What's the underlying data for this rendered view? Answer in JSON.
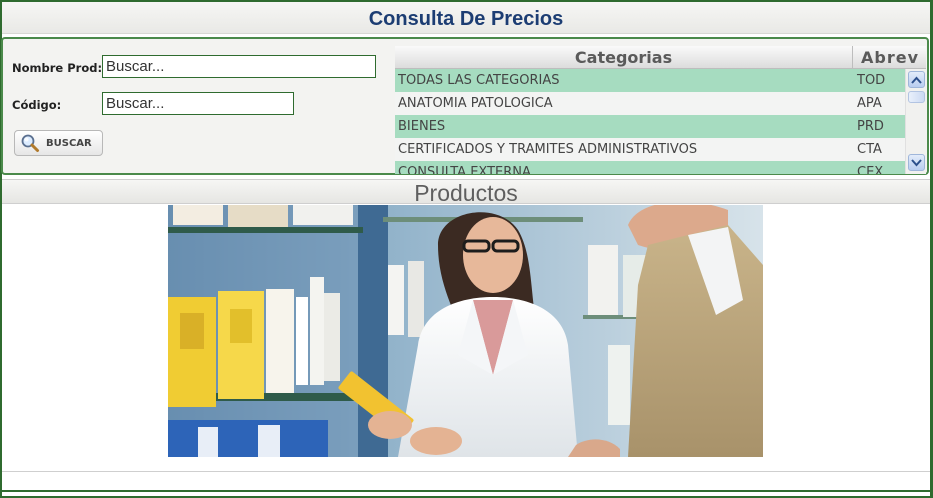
{
  "header": {
    "title": "Consulta De Precios"
  },
  "search": {
    "nombre_label": "Nombre Prod:",
    "nombre_value": "Buscar...",
    "codigo_label": "Código:",
    "codigo_value": "Buscar...",
    "button_label": "BUSCAR",
    "button_icon": "magnifier-icon"
  },
  "categories": {
    "columns": [
      "Categorias",
      "Abrev"
    ],
    "rows": [
      {
        "name": "TODAS LAS CATEGORIAS",
        "abrev": "TOD"
      },
      {
        "name": "ANATOMIA PATOLOGICA",
        "abrev": "APA"
      },
      {
        "name": "BIENES",
        "abrev": "PRD"
      },
      {
        "name": "CERTIFICADOS Y TRAMITES ADMINISTRATIVOS",
        "abrev": "CTA"
      },
      {
        "name": "CONSULTA EXTERNA",
        "abrev": "CEX"
      }
    ],
    "row_color_alt": "#a6dcc0",
    "row_color_plain": "#f3f4f3"
  },
  "products": {
    "title": "Productos"
  },
  "colors": {
    "border": "#2f6b2f",
    "title": "#1c3d73",
    "accent": "#a6dcc0"
  }
}
